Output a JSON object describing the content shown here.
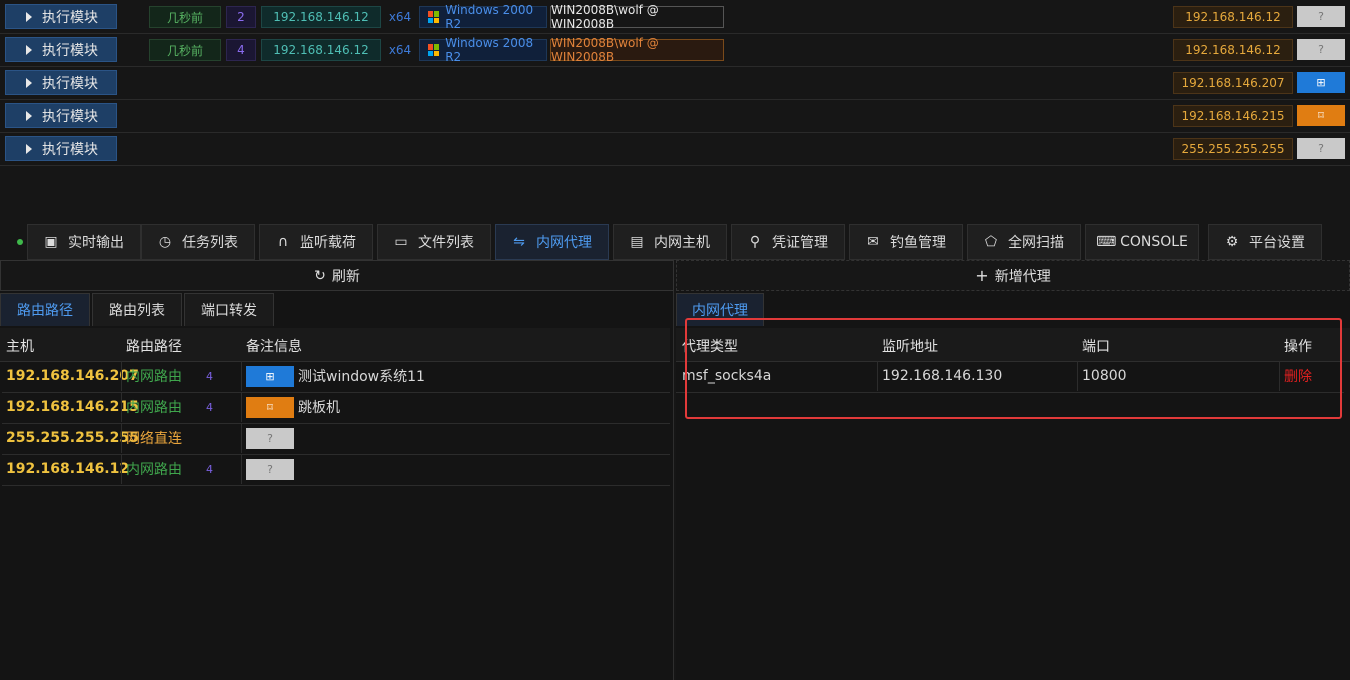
{
  "sessions": [
    {
      "exec_label": "执行模块",
      "time": "几秒前",
      "count": "2",
      "ip": "192.168.146.12",
      "arch": "x64",
      "os": "Windows 2000 R2",
      "user": "WIN2008B\\wolf @ WIN2008B",
      "user_highlight": false,
      "remote_ip": "192.168.146.12",
      "badge": "?",
      "badge_color": "gray"
    },
    {
      "exec_label": "执行模块",
      "time": "几秒前",
      "count": "4",
      "ip": "192.168.146.12",
      "arch": "x64",
      "os": "Windows 2008 R2",
      "user": "WIN2008B\\wolf @ WIN2008B",
      "user_highlight": true,
      "remote_ip": "192.168.146.12",
      "badge": "?",
      "badge_color": "gray"
    },
    {
      "exec_label": "执行模块",
      "remote_ip": "192.168.146.207",
      "badge": "⊞",
      "badge_color": "blue"
    },
    {
      "exec_label": "执行模块",
      "remote_ip": "192.168.146.215",
      "badge": "⌑",
      "badge_color": "orange"
    },
    {
      "exec_label": "执行模块",
      "remote_ip": "255.255.255.255",
      "badge": "?",
      "badge_color": "gray"
    }
  ],
  "tabs": [
    {
      "icon": "▣",
      "icon_name": "output-icon",
      "label": "实时输出",
      "active": false
    },
    {
      "icon": "◷",
      "icon_name": "clock-icon",
      "label": "任务列表",
      "active": false
    },
    {
      "icon": "∩",
      "icon_name": "headphones-icon",
      "label": "监听载荷",
      "active": false
    },
    {
      "icon": "▭",
      "icon_name": "folder-icon",
      "label": "文件列表",
      "active": false
    },
    {
      "icon": "⇋",
      "icon_name": "proxy-icon",
      "label": "内网代理",
      "active": true
    },
    {
      "icon": "▤",
      "icon_name": "host-icon",
      "label": "内网主机",
      "active": false
    },
    {
      "icon": "⚲",
      "icon_name": "key-icon",
      "label": "凭证管理",
      "active": false
    },
    {
      "icon": "✉",
      "icon_name": "mail-icon",
      "label": "钓鱼管理",
      "active": false
    },
    {
      "icon": "⬠",
      "icon_name": "scan-icon",
      "label": "全网扫描",
      "active": false
    },
    {
      "icon": "⌨",
      "icon_name": "console-icon",
      "label": "CONSOLE",
      "active": false
    },
    {
      "icon": "⚙",
      "icon_name": "gear-icon",
      "label": "平台设置",
      "active": false
    }
  ],
  "left": {
    "refresh_label": "刷新",
    "subtabs": [
      "路由路径",
      "路由列表",
      "端口转发"
    ],
    "headers": [
      "主机",
      "路由路径",
      "备注信息"
    ],
    "rows": [
      {
        "host": "192.168.146.207",
        "route": "内网路由",
        "route_type": "in",
        "hop": "4",
        "badge": "⊞",
        "badge_color": "blue",
        "note": "测试window系统11"
      },
      {
        "host": "192.168.146.215",
        "route": "内网路由",
        "route_type": "in",
        "hop": "4",
        "badge": "⌑",
        "badge_color": "orange",
        "note": "跳板机"
      },
      {
        "host": "255.255.255.255",
        "route": "网络直连",
        "route_type": "direct",
        "hop": "",
        "badge": "?",
        "badge_color": "gray",
        "note": ""
      },
      {
        "host": "192.168.146.12",
        "route": "内网路由",
        "route_type": "in",
        "hop": "4",
        "badge": "?",
        "badge_color": "gray",
        "note": ""
      }
    ]
  },
  "right": {
    "add_label": "新增代理",
    "subtab": "内网代理",
    "headers": [
      "代理类型",
      "监听地址",
      "端口",
      "操作"
    ],
    "rows": [
      {
        "type": "msf_socks4a",
        "address": "192.168.146.130",
        "port": "10800",
        "action": "删除"
      }
    ]
  }
}
